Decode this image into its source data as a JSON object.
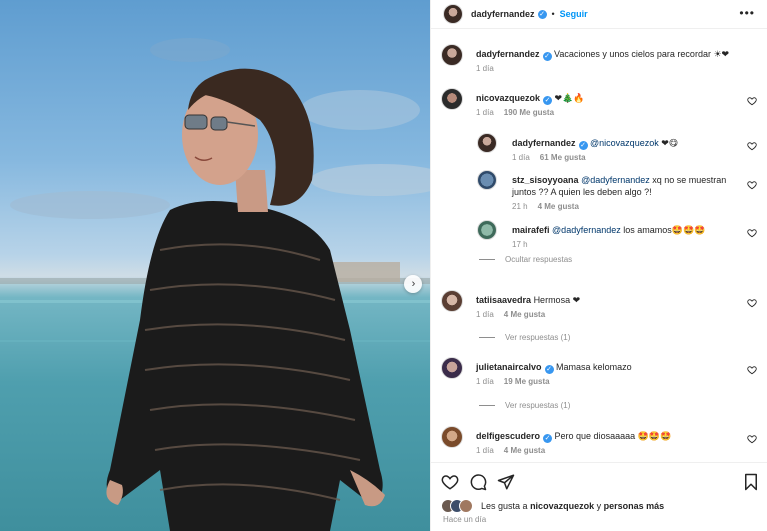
{
  "post": {
    "username": "dadyfernandez",
    "follow_label": "Seguir",
    "dot": "•",
    "more_label": "•••"
  },
  "comments": [
    {
      "username": "dadyfernandez",
      "verified": true,
      "text": "Vacaciones y unos cielos para recordar",
      "emoji": "☀❤",
      "time": "1 día",
      "likes": ""
    },
    {
      "username": "nicovazquezok",
      "verified": true,
      "text": "",
      "emoji": "❤🎄🔥",
      "time": "1 día",
      "likes": "190 Me gusta"
    },
    {
      "username": "dadyfernandez",
      "verified": true,
      "mention": "@nicovazquezok",
      "text": "",
      "emoji": "❤😋",
      "time": "1 día",
      "likes": "61 Me gusta"
    },
    {
      "username": "stz_sisoyyoana",
      "verified": false,
      "mention": "@dadyfernandez",
      "text": "xq no se muestran juntos ?? A quien les deben algo ?!",
      "time": "21 h",
      "likes": "4 Me gusta"
    },
    {
      "username": "mairafefi",
      "verified": false,
      "mention": "@dadyfernandez",
      "text": "los amamos",
      "emoji": "🤩🤩🤩",
      "time": "17 h",
      "likes": ""
    },
    {
      "username": "tatiisaavedra",
      "verified": false,
      "text": "Hermosa",
      "emoji": "❤",
      "time": "1 día",
      "likes": "4 Me gusta"
    },
    {
      "username": "julietanaircalvo",
      "verified": true,
      "text": "Mamasa kelomazo",
      "time": "1 día",
      "likes": "19 Me gusta"
    },
    {
      "username": "delfigescudero",
      "verified": true,
      "text": "Pero que diosaaaaa",
      "emoji": "🤩🤩🤩",
      "time": "1 día",
      "likes": "4 Me gusta"
    }
  ],
  "thread": {
    "hide_replies": "Ocultar respuestas",
    "view_replies_1": "Ver respuestas (1)",
    "view_replies_2": "Ver respuestas (1)"
  },
  "footer": {
    "likes_prefix": "Les gusta a",
    "likes_user": "nicovazquezok",
    "likes_suffix": "y",
    "likes_more": "personas más",
    "timestamp": "Hace un día"
  },
  "colors": {
    "accent": "#0095f6",
    "verified": "#3897f0",
    "heart": "#ed4956"
  },
  "icons": [
    "heart-icon",
    "comment-icon",
    "share-icon",
    "bookmark-icon",
    "more-icon",
    "chevron-right-icon",
    "verified-icon"
  ]
}
